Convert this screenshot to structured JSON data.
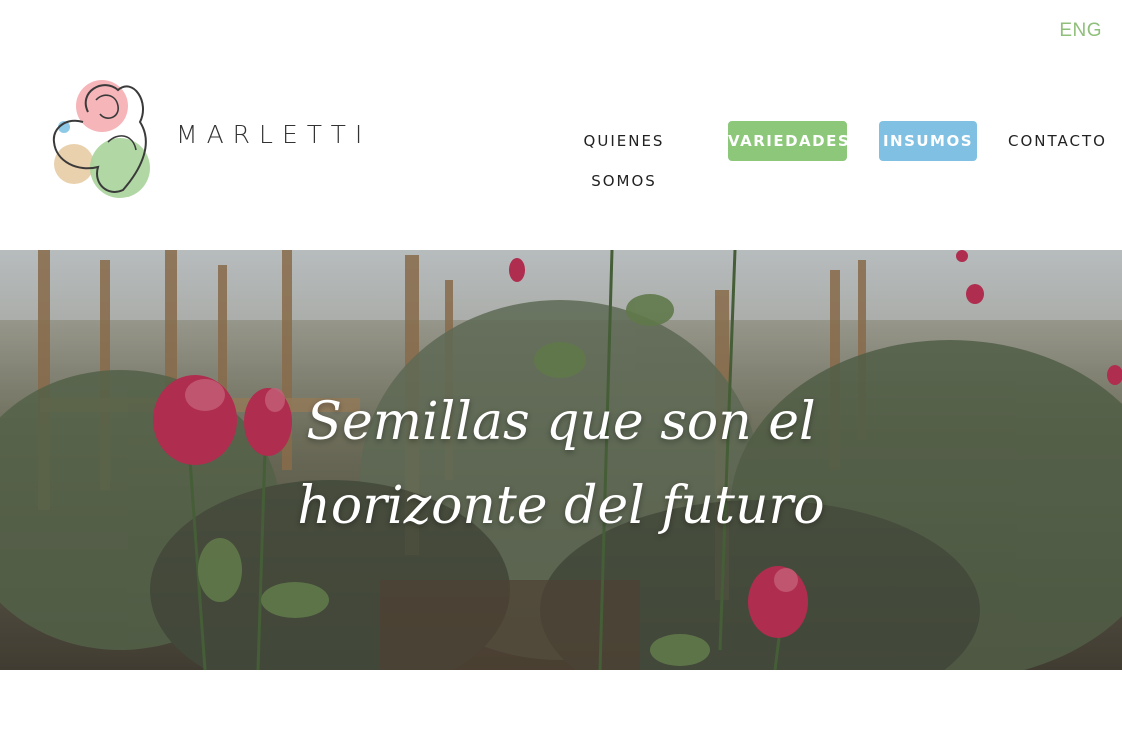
{
  "header": {
    "language_label": "ENG",
    "brand_name": "MARLETTI"
  },
  "nav": {
    "items": [
      {
        "label": "QUIENES SOMOS"
      },
      {
        "label": "VARIEDADES"
      },
      {
        "label": "INSUMOS"
      },
      {
        "label": "CONTACTO"
      }
    ]
  },
  "hero": {
    "title_line1": "Semillas que son el",
    "title_line2": "horizonte del futuro"
  },
  "colors": {
    "green_accent": "#8cc77a",
    "blue_accent": "#7fc0e3",
    "lang_green": "#8fbf7a",
    "rose": "#c8345a"
  }
}
